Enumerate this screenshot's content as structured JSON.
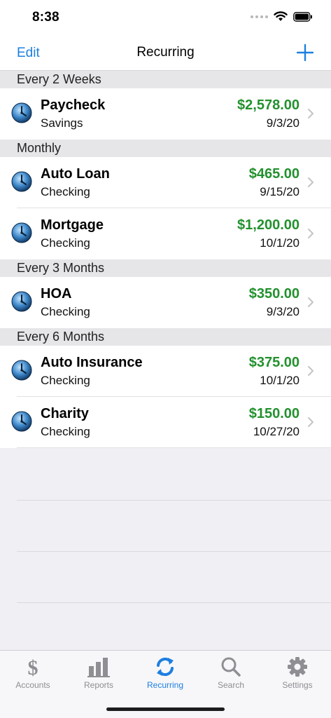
{
  "status": {
    "time": "8:38"
  },
  "nav": {
    "edit_label": "Edit",
    "title": "Recurring",
    "add_icon": "plus-icon"
  },
  "sections": [
    {
      "title": "Every 2 Weeks",
      "rows": [
        {
          "name": "Paycheck",
          "account": "Savings",
          "amount": "$2,578.00",
          "date": "9/3/20"
        }
      ]
    },
    {
      "title": "Monthly",
      "rows": [
        {
          "name": "Auto Loan",
          "account": "Checking",
          "amount": "$465.00",
          "date": "9/15/20"
        },
        {
          "name": "Mortgage",
          "account": "Checking",
          "amount": "$1,200.00",
          "date": "10/1/20"
        }
      ]
    },
    {
      "title": "Every 3 Months",
      "rows": [
        {
          "name": "HOA",
          "account": "Checking",
          "amount": "$350.00",
          "date": "9/3/20"
        }
      ]
    },
    {
      "title": "Every 6 Months",
      "rows": [
        {
          "name": "Auto Insurance",
          "account": "Checking",
          "amount": "$375.00",
          "date": "10/1/20"
        },
        {
          "name": "Charity",
          "account": "Checking",
          "amount": "$150.00",
          "date": "10/27/20"
        }
      ]
    }
  ],
  "tabs": [
    {
      "label": "Accounts",
      "icon": "dollar-icon"
    },
    {
      "label": "Reports",
      "icon": "bar-chart-icon"
    },
    {
      "label": "Recurring",
      "icon": "refresh-icon",
      "active": true
    },
    {
      "label": "Search",
      "icon": "search-icon"
    },
    {
      "label": "Settings",
      "icon": "gear-icon"
    }
  ],
  "colors": {
    "accent": "#1d7fe0",
    "amount_green": "#23912e",
    "section_bg": "#e6e6e9"
  }
}
